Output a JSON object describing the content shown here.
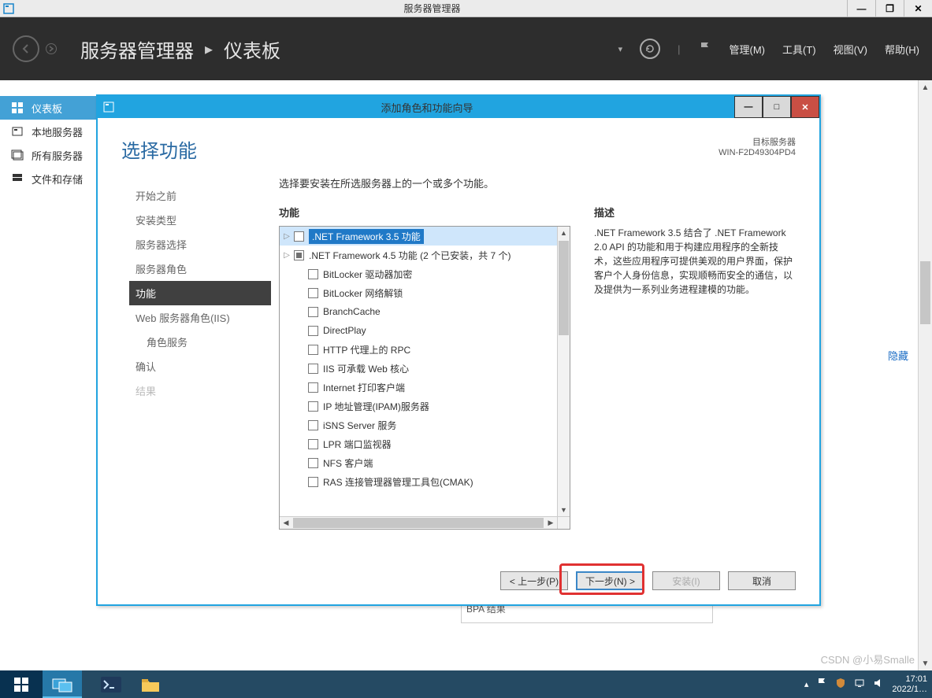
{
  "window": {
    "title": "服务器管理器",
    "controls": {
      "minimize": "—",
      "maximize": "❐",
      "close": "✕"
    }
  },
  "header": {
    "breadcrumb": {
      "app": "服务器管理器",
      "page": "仪表板",
      "sep": "•"
    },
    "menu": {
      "manage": "管理(M)",
      "tools": "工具(T)",
      "view": "视图(V)",
      "help": "帮助(H)"
    }
  },
  "sidebar": {
    "items": [
      {
        "label": "仪表板",
        "icon": "dashboard"
      },
      {
        "label": "本地服务器",
        "icon": "server"
      },
      {
        "label": "所有服务器",
        "icon": "servers"
      },
      {
        "label": "文件和存储",
        "icon": "storage"
      }
    ],
    "selected": 0
  },
  "main": {
    "hide_link": "隐藏",
    "bpa_leftover": "BPA 结果"
  },
  "dialog": {
    "title": "添加角色和功能向导",
    "controls": {
      "minimize": "—",
      "maximize": "□",
      "close": "✕"
    },
    "heading": "选择功能",
    "target_server_label": "目标服务器",
    "target_server": "WIN-F2D49304PD4",
    "steps": [
      {
        "label": "开始之前"
      },
      {
        "label": "安装类型"
      },
      {
        "label": "服务器选择"
      },
      {
        "label": "服务器角色"
      },
      {
        "label": "功能",
        "active": true
      },
      {
        "label": "Web 服务器角色(IIS)"
      },
      {
        "label": "角色服务",
        "indent": true
      },
      {
        "label": "确认"
      },
      {
        "label": "结果",
        "disabled": true
      }
    ],
    "instruction": "选择要安装在所选服务器上的一个或多个功能。",
    "features_header": "功能",
    "description_header": "描述",
    "features": [
      {
        "label": ".NET Framework 3.5 功能",
        "expandable": true,
        "selected": true
      },
      {
        "label": ".NET Framework 4.5 功能 (2 个已安装，共 7 个)",
        "expandable": true,
        "mixed": true
      },
      {
        "label": "BitLocker 驱动器加密"
      },
      {
        "label": "BitLocker 网络解锁"
      },
      {
        "label": "BranchCache"
      },
      {
        "label": "DirectPlay"
      },
      {
        "label": "HTTP 代理上的 RPC"
      },
      {
        "label": "IIS 可承载 Web 核心"
      },
      {
        "label": "Internet 打印客户端"
      },
      {
        "label": "IP 地址管理(IPAM)服务器"
      },
      {
        "label": "iSNS Server 服务"
      },
      {
        "label": "LPR 端口监视器"
      },
      {
        "label": "NFS 客户端"
      },
      {
        "label": "RAS 连接管理器管理工具包(CMAK)"
      }
    ],
    "description": ".NET Framework 3.5 结合了 .NET Framework 2.0 API 的功能和用于构建应用程序的全新技术，这些应用程序可提供美观的用户界面，保护客户个人身份信息，实现顺畅而安全的通信，以及提供为一系列业务进程建模的功能。",
    "buttons": {
      "prev": "< 上一步(P)",
      "next": "下一步(N) >",
      "install": "安装(I)",
      "cancel": "取消"
    }
  },
  "taskbar": {
    "clock_time": "17:01",
    "clock_date": "2022/1…"
  },
  "watermark": "CSDN @小易Smalle"
}
